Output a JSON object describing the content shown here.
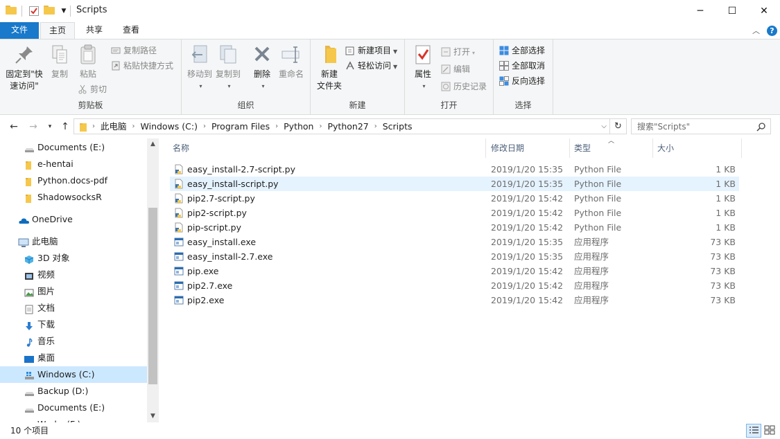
{
  "window": {
    "title": "Scripts",
    "controls": {
      "minimize": "─",
      "maximize": "☐",
      "close": "✕"
    }
  },
  "ribbon_tabs": [
    "文件",
    "主页",
    "共享",
    "查看"
  ],
  "ribbon": {
    "clipboard": {
      "label": "剪贴板",
      "pin_line1": "固定到\"快",
      "pin_line2": "速访问\"",
      "copy": "复制",
      "paste": "粘贴",
      "copy_path": "复制路径",
      "paste_shortcut": "粘贴快捷方式",
      "cut": "剪切"
    },
    "organize": {
      "label": "组织",
      "move_to": "移动到",
      "copy_to": "复制到",
      "delete": "删除",
      "rename": "重命名"
    },
    "new": {
      "label": "新建",
      "new_folder_line1": "新建",
      "new_folder_line2": "文件夹",
      "new_item": "新建项目",
      "easy_access": "轻松访问"
    },
    "open": {
      "label": "打开",
      "properties": "属性",
      "open": "打开",
      "edit": "编辑",
      "history": "历史记录"
    },
    "select": {
      "label": "选择",
      "select_all": "全部选择",
      "select_none": "全部取消",
      "invert": "反向选择"
    }
  },
  "address": {
    "crumbs": [
      "此电脑",
      "Windows (C:)",
      "Program Files",
      "Python",
      "Python27",
      "Scripts"
    ],
    "search_placeholder": "搜索\"Scripts\""
  },
  "nav_pane": {
    "items": [
      {
        "label": "Documents (E:)",
        "icon": "drive-icon",
        "indent": 1
      },
      {
        "label": "e-hentai",
        "icon": "folder-icon",
        "indent": 1
      },
      {
        "label": "Python.docs-pdf",
        "icon": "folder-icon",
        "indent": 1
      },
      {
        "label": "ShadowsocksR",
        "icon": "folder-icon",
        "indent": 1
      },
      {
        "label": "OneDrive",
        "icon": "onedrive-icon",
        "indent": 0
      },
      {
        "label": "此电脑",
        "icon": "computer-icon",
        "indent": 0
      },
      {
        "label": "3D 对象",
        "icon": "3d-objects-icon",
        "indent": 1
      },
      {
        "label": "视频",
        "icon": "video-icon",
        "indent": 1
      },
      {
        "label": "图片",
        "icon": "pictures-icon",
        "indent": 1
      },
      {
        "label": "文档",
        "icon": "documents-icon",
        "indent": 1
      },
      {
        "label": "下载",
        "icon": "download-icon",
        "indent": 1
      },
      {
        "label": "音乐",
        "icon": "music-icon",
        "indent": 1
      },
      {
        "label": "桌面",
        "icon": "desktop-icon",
        "indent": 1
      },
      {
        "label": "Windows (C:)",
        "icon": "windows-drive-icon",
        "indent": 1,
        "selected": true
      },
      {
        "label": "Backup (D:)",
        "icon": "drive-icon",
        "indent": 1
      },
      {
        "label": "Documents (E:)",
        "icon": "drive-icon",
        "indent": 1
      },
      {
        "label": "Works (F:)",
        "icon": "drive-icon",
        "indent": 1
      }
    ]
  },
  "file_list": {
    "columns": [
      "名称",
      "修改日期",
      "类型",
      "大小"
    ],
    "rows": [
      {
        "name": "easy_install-2.7-script.py",
        "date": "2019/1/20 15:35",
        "type": "Python File",
        "size": "1 KB",
        "icon": "python-file-icon"
      },
      {
        "name": "easy_install-script.py",
        "date": "2019/1/20 15:35",
        "type": "Python File",
        "size": "1 KB",
        "icon": "python-file-icon",
        "hover": true
      },
      {
        "name": "pip2.7-script.py",
        "date": "2019/1/20 15:42",
        "type": "Python File",
        "size": "1 KB",
        "icon": "python-file-icon"
      },
      {
        "name": "pip2-script.py",
        "date": "2019/1/20 15:42",
        "type": "Python File",
        "size": "1 KB",
        "icon": "python-file-icon"
      },
      {
        "name": "pip-script.py",
        "date": "2019/1/20 15:42",
        "type": "Python File",
        "size": "1 KB",
        "icon": "python-file-icon"
      },
      {
        "name": "easy_install.exe",
        "date": "2019/1/20 15:35",
        "type": "应用程序",
        "size": "73 KB",
        "icon": "exe-file-icon"
      },
      {
        "name": "easy_install-2.7.exe",
        "date": "2019/1/20 15:35",
        "type": "应用程序",
        "size": "73 KB",
        "icon": "exe-file-icon"
      },
      {
        "name": "pip.exe",
        "date": "2019/1/20 15:42",
        "type": "应用程序",
        "size": "73 KB",
        "icon": "exe-file-icon"
      },
      {
        "name": "pip2.7.exe",
        "date": "2019/1/20 15:42",
        "type": "应用程序",
        "size": "73 KB",
        "icon": "exe-file-icon"
      },
      {
        "name": "pip2.exe",
        "date": "2019/1/20 15:42",
        "type": "应用程序",
        "size": "73 KB",
        "icon": "exe-file-icon"
      }
    ]
  },
  "status": {
    "count": "10 个项目"
  },
  "colors": {
    "accent": "#1979ca",
    "selected": "#cce8ff",
    "hover": "#e5f3ff",
    "header_text": "#4c607a"
  }
}
